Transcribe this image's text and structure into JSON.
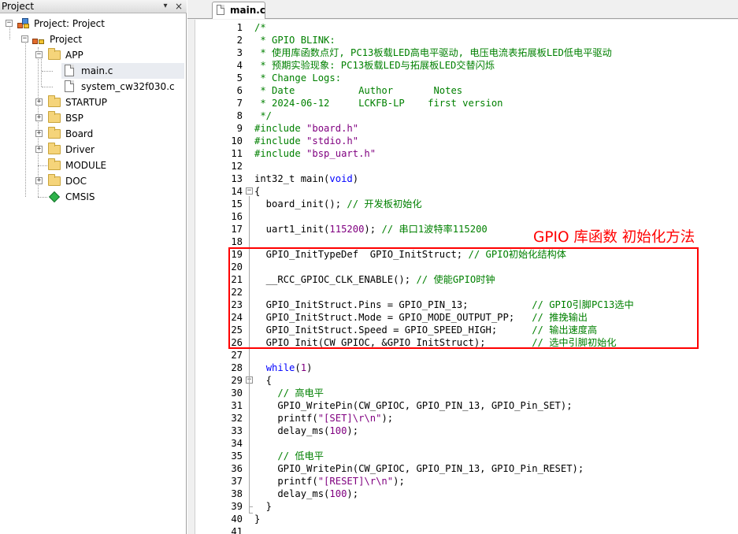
{
  "project_panel": {
    "title": "Project",
    "pin_glyph": "📌",
    "close_glyph": "×",
    "tree": [
      {
        "label": "Project: Project",
        "icon": "project-root-icon"
      },
      {
        "label": "Project",
        "icon": "target-icon"
      },
      {
        "label": "APP",
        "icon": "folder-open-icon"
      },
      {
        "label": "main.c",
        "icon": "file-icon"
      },
      {
        "label": "system_cw32f030.c",
        "icon": "file-icon"
      },
      {
        "label": "STARTUP",
        "icon": "folder-icon"
      },
      {
        "label": "BSP",
        "icon": "folder-icon"
      },
      {
        "label": "Board",
        "icon": "folder-icon"
      },
      {
        "label": "Driver",
        "icon": "folder-icon"
      },
      {
        "label": "MODULE",
        "icon": "folder-icon"
      },
      {
        "label": "DOC",
        "icon": "folder-icon"
      },
      {
        "label": "CMSIS",
        "icon": "gem-icon"
      }
    ],
    "expanders": {
      "collapsed": "+",
      "expanded": "−"
    }
  },
  "editor": {
    "tab_label": "main.c",
    "fold_open": "−",
    "annotation": "GPIO 库函数 初始化方法",
    "lines": [
      {
        "n": "1",
        "segs": [
          {
            "t": "/*",
            "c": "comment"
          }
        ]
      },
      {
        "n": "2",
        "segs": [
          {
            "t": " * GPIO BLINK:",
            "c": "comment"
          }
        ]
      },
      {
        "n": "3",
        "segs": [
          {
            "t": " * 使用库函数点灯, PC13板载LED高电平驱动, 电压电流表拓展板LED低电平驱动",
            "c": "comment"
          }
        ]
      },
      {
        "n": "4",
        "segs": [
          {
            "t": " * 预期实验现象: PC13板载LED与拓展板LED交替闪烁",
            "c": "comment"
          }
        ]
      },
      {
        "n": "5",
        "segs": [
          {
            "t": " * Change Logs:",
            "c": "comment"
          }
        ]
      },
      {
        "n": "6",
        "segs": [
          {
            "t": " * Date           Author       Notes",
            "c": "comment"
          }
        ]
      },
      {
        "n": "7",
        "segs": [
          {
            "t": " * 2024-06-12     LCKFB-LP    first version",
            "c": "comment"
          }
        ]
      },
      {
        "n": "8",
        "segs": [
          {
            "t": " */",
            "c": "comment"
          }
        ]
      },
      {
        "n": "9",
        "segs": [
          {
            "t": "#include ",
            "c": "comment"
          },
          {
            "t": "\"board.h\"",
            "c": "string"
          }
        ]
      },
      {
        "n": "10",
        "segs": [
          {
            "t": "#include ",
            "c": "comment"
          },
          {
            "t": "\"stdio.h\"",
            "c": "string"
          }
        ]
      },
      {
        "n": "11",
        "segs": [
          {
            "t": "#include ",
            "c": "comment"
          },
          {
            "t": "\"bsp_uart.h\"",
            "c": "string"
          }
        ]
      },
      {
        "n": "12",
        "segs": []
      },
      {
        "n": "13",
        "segs": [
          {
            "t": "int32_t main(",
            "c": "plain"
          },
          {
            "t": "void",
            "c": "kw"
          },
          {
            "t": ")",
            "c": "plain"
          }
        ]
      },
      {
        "n": "14",
        "segs": [
          {
            "t": "{",
            "c": "plain"
          }
        ],
        "fold": true
      },
      {
        "n": "15",
        "segs": [
          {
            "t": "  board_init(); ",
            "c": "plain"
          },
          {
            "t": "// 开发板初始化",
            "c": "comment"
          }
        ]
      },
      {
        "n": "16",
        "segs": []
      },
      {
        "n": "17",
        "segs": [
          {
            "t": "  uart1_init(",
            "c": "plain"
          },
          {
            "t": "115200",
            "c": "num"
          },
          {
            "t": "); ",
            "c": "plain"
          },
          {
            "t": "// 串口1波特率115200",
            "c": "comment"
          }
        ]
      },
      {
        "n": "18",
        "segs": []
      },
      {
        "n": "19",
        "segs": [
          {
            "t": "  GPIO_InitTypeDef  GPIO_InitStruct; ",
            "c": "plain"
          },
          {
            "t": "// GPIO初始化结构体",
            "c": "comment"
          }
        ]
      },
      {
        "n": "20",
        "segs": []
      },
      {
        "n": "21",
        "segs": [
          {
            "t": "  __RCC_GPIOC_CLK_ENABLE(); ",
            "c": "plain"
          },
          {
            "t": "// 使能GPIO时钟",
            "c": "comment"
          }
        ]
      },
      {
        "n": "22",
        "segs": []
      },
      {
        "n": "23",
        "segs": [
          {
            "t": "  GPIO_InitStruct.Pins = GPIO_PIN_13;           ",
            "c": "plain"
          },
          {
            "t": "// GPIO引脚PC13选中",
            "c": "comment"
          }
        ]
      },
      {
        "n": "24",
        "segs": [
          {
            "t": "  GPIO_InitStruct.Mode = GPIO_MODE_OUTPUT_PP;   ",
            "c": "plain"
          },
          {
            "t": "// 推挽输出",
            "c": "comment"
          }
        ]
      },
      {
        "n": "25",
        "segs": [
          {
            "t": "  GPIO_InitStruct.Speed = GPIO_SPEED_HIGH;      ",
            "c": "plain"
          },
          {
            "t": "// 输出速度高",
            "c": "comment"
          }
        ]
      },
      {
        "n": "26",
        "segs": [
          {
            "t": "  GPIO_Init(CW_GPIOC, &GPIO_InitStruct);        ",
            "c": "plain"
          },
          {
            "t": "// 选中引脚初始化",
            "c": "comment"
          }
        ]
      },
      {
        "n": "27",
        "segs": []
      },
      {
        "n": "28",
        "segs": [
          {
            "t": "  ",
            "c": "plain"
          },
          {
            "t": "while",
            "c": "kw"
          },
          {
            "t": "(",
            "c": "plain"
          },
          {
            "t": "1",
            "c": "num"
          },
          {
            "t": ")",
            "c": "plain"
          }
        ]
      },
      {
        "n": "29",
        "segs": [
          {
            "t": "  {",
            "c": "plain"
          }
        ],
        "fold": true
      },
      {
        "n": "30",
        "segs": [
          {
            "t": "    ",
            "c": "plain"
          },
          {
            "t": "// 高电平",
            "c": "comment"
          }
        ]
      },
      {
        "n": "31",
        "segs": [
          {
            "t": "    GPIO_WritePin(CW_GPIOC, GPIO_PIN_13, GPIO_Pin_SET);",
            "c": "plain"
          }
        ]
      },
      {
        "n": "32",
        "segs": [
          {
            "t": "    printf(",
            "c": "plain"
          },
          {
            "t": "\"[SET]\\r\\n\"",
            "c": "string"
          },
          {
            "t": ");",
            "c": "plain"
          }
        ]
      },
      {
        "n": "33",
        "segs": [
          {
            "t": "    delay_ms(",
            "c": "plain"
          },
          {
            "t": "100",
            "c": "num"
          },
          {
            "t": ");",
            "c": "plain"
          }
        ]
      },
      {
        "n": "34",
        "segs": []
      },
      {
        "n": "35",
        "segs": [
          {
            "t": "    ",
            "c": "plain"
          },
          {
            "t": "// 低电平",
            "c": "comment"
          }
        ]
      },
      {
        "n": "36",
        "segs": [
          {
            "t": "    GPIO_WritePin(CW_GPIOC, GPIO_PIN_13, GPIO_Pin_RESET);",
            "c": "plain"
          }
        ]
      },
      {
        "n": "37",
        "segs": [
          {
            "t": "    printf(",
            "c": "plain"
          },
          {
            "t": "\"[RESET]\\r\\n\"",
            "c": "string"
          },
          {
            "t": ");",
            "c": "plain"
          }
        ]
      },
      {
        "n": "38",
        "segs": [
          {
            "t": "    delay_ms(",
            "c": "plain"
          },
          {
            "t": "100",
            "c": "num"
          },
          {
            "t": ");",
            "c": "plain"
          }
        ]
      },
      {
        "n": "39",
        "segs": [
          {
            "t": "  }",
            "c": "plain"
          }
        ]
      },
      {
        "n": "40",
        "segs": [
          {
            "t": "}",
            "c": "plain"
          }
        ]
      },
      {
        "n": "41",
        "segs": []
      }
    ]
  },
  "colors": {
    "comment": "#008000",
    "string": "#800080",
    "keyword": "#0000ff",
    "highlight_box": "#ff0000",
    "annotation": "#ff0000"
  }
}
